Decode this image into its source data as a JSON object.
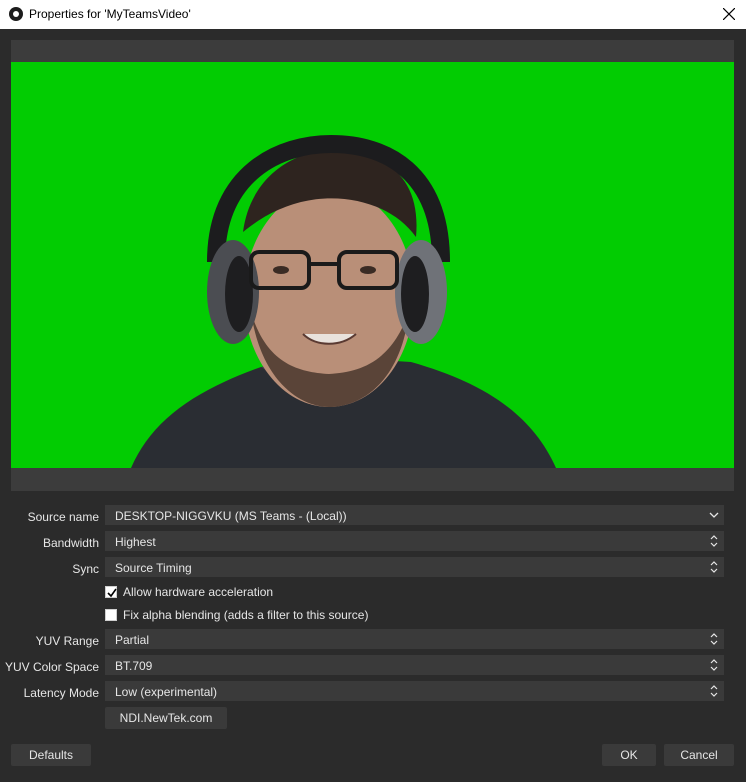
{
  "window": {
    "title": "Properties for 'MyTeamsVideo'",
    "icon": "obs-icon",
    "close_icon": "close-icon"
  },
  "preview": {
    "background_color": "#02cc02",
    "content": "webcam-preview-person-with-headset"
  },
  "form": {
    "source_name": {
      "label": "Source name",
      "value": "DESKTOP-NIGGVKU (MS Teams - (Local))"
    },
    "bandwidth": {
      "label": "Bandwidth",
      "value": "Highest"
    },
    "sync": {
      "label": "Sync",
      "value": "Source Timing"
    },
    "hw_accel": {
      "label": "Allow hardware acceleration",
      "checked": true
    },
    "alpha_blend": {
      "label": "Fix alpha blending (adds a filter to this source)",
      "checked": false
    },
    "yuv_range": {
      "label": "YUV Range",
      "value": "Partial"
    },
    "yuv_color_space": {
      "label": "YUV Color Space",
      "value": "BT.709"
    },
    "latency_mode": {
      "label": "Latency Mode",
      "value": "Low (experimental)"
    },
    "ndi_link": {
      "label": "NDI.NewTek.com"
    }
  },
  "buttons": {
    "defaults": "Defaults",
    "ok": "OK",
    "cancel": "Cancel"
  }
}
